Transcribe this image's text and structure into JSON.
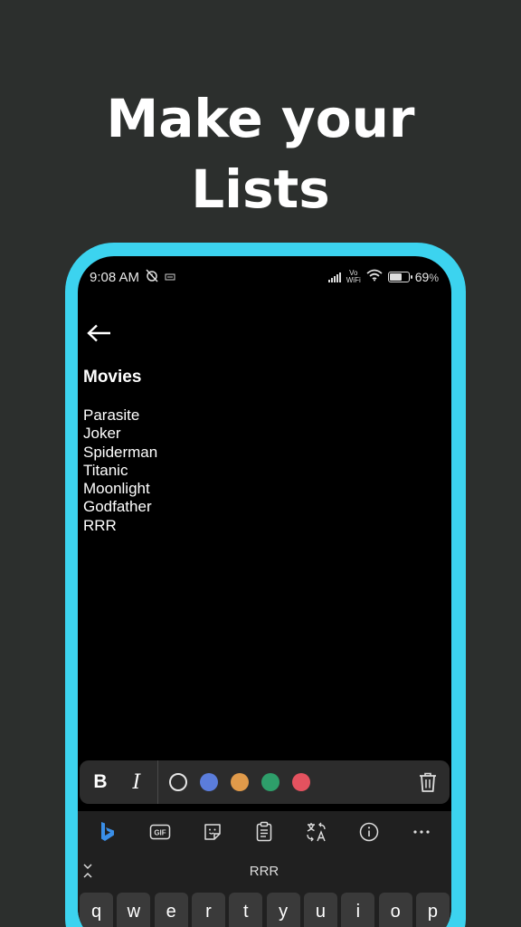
{
  "headline": {
    "line1": "Make your",
    "line2": "Lists"
  },
  "status_bar": {
    "time": "9:08 AM",
    "network_label_top": "Vo",
    "network_label_bottom": "WiFi",
    "battery_percent": "69",
    "battery_unit": "%",
    "battery_level": 0.69
  },
  "note": {
    "title": "Movies",
    "items": [
      "Parasite",
      "Joker",
      "Spiderman",
      "Titanic",
      "Moonlight",
      "Godfather",
      "RRR"
    ]
  },
  "format_toolbar": {
    "bold_label": "B",
    "italic_label": "I",
    "colors": [
      "#5b7ddb",
      "#e09a4a",
      "#2e9e6a",
      "#e4525f"
    ]
  },
  "keyboard": {
    "gif_label": "GIF",
    "suggestion": "RRR",
    "keys": [
      "q",
      "w",
      "e",
      "r",
      "t",
      "y",
      "u",
      "i",
      "o",
      "p"
    ]
  },
  "colors": {
    "background": "#2c2f2d",
    "frame_accent": "#3cd3ef",
    "screen": "#000000"
  }
}
